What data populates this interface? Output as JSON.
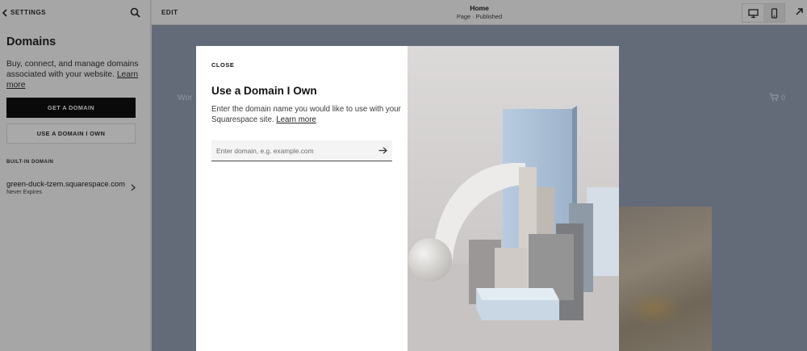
{
  "sidebar": {
    "back_label": "SETTINGS",
    "title": "Domains",
    "description": "Buy, connect, and manage domains associated with your website.",
    "learn_more": "Learn more",
    "get_domain_label": "GET A DOMAIN",
    "use_domain_label": "USE A DOMAIN I OWN",
    "builtin_heading": "BUILT-IN DOMAIN",
    "builtin_domain": {
      "name": "green-duck-tzem.squarespace.com",
      "expiry": "Never Expires"
    }
  },
  "topbar": {
    "edit_label": "EDIT",
    "page_title": "Home",
    "page_status": "Page · Published",
    "active_device": "mobile"
  },
  "canvas": {
    "nav_item": "Wor",
    "cart_count": "0"
  },
  "modal": {
    "close_label": "CLOSE",
    "title": "Use a Domain I Own",
    "description": "Enter the domain name you would like to use with your Squarespace site.",
    "learn_more": "Learn more",
    "input_placeholder": "Enter domain, e.g. example.com",
    "input_value": ""
  },
  "colors": {
    "primary_button": "#0a0a0a",
    "overlay_dim": "#9b9b9b",
    "modal_bg": "#ffffff"
  }
}
